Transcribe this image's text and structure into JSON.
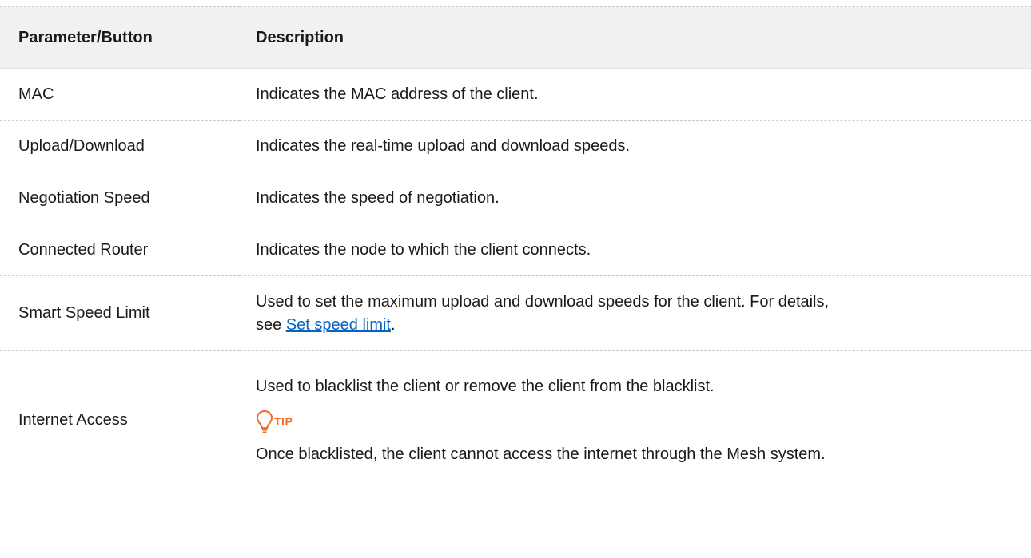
{
  "table": {
    "headers": {
      "param": "Parameter/Button",
      "desc": "Description"
    },
    "rows": [
      {
        "param": "MAC",
        "desc": "Indicates the MAC address of the client."
      },
      {
        "param": "Upload/Download",
        "desc": "Indicates the real-time upload and download speeds."
      },
      {
        "param": "Negotiation Speed",
        "desc": "Indicates the speed of negotiation."
      },
      {
        "param": "Connected Router",
        "desc": "Indicates the node to which the client connects."
      },
      {
        "param": "Smart Speed Limit",
        "desc_line1": "Used to set the maximum upload and download speeds for the client. For details,",
        "desc_prefix": "see ",
        "link_text": "Set speed limit",
        "desc_suffix": "."
      },
      {
        "param": "Internet Access",
        "desc_line1": "Used to blacklist the client or remove the client from the blacklist.",
        "tip_label": "TIP",
        "tip_icon": "lightbulb-icon",
        "tip_text": "Once blacklisted, the client cannot access the internet through the Mesh system."
      }
    ]
  },
  "colors": {
    "link": "#0563c1",
    "tip_accent": "#f26d21",
    "header_bg": "#f1f1f1"
  }
}
